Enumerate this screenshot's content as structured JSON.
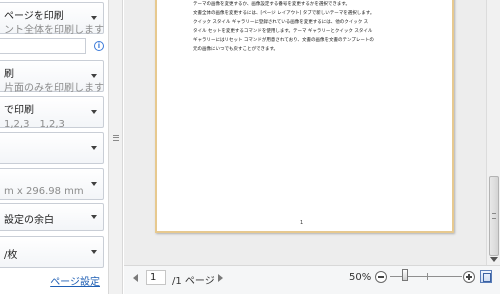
{
  "settings": {
    "print_pages": {
      "title": "ページを印刷",
      "subtitle": "ント全体を印刷します"
    },
    "sides": {
      "title": "刷",
      "subtitle": "片面のみを印刷します"
    },
    "collate": {
      "title": "で印刷",
      "subtitle": "1,2,3　1,2,3"
    },
    "paper_size": {
      "subtitle": "m x 296.98 mm"
    },
    "margins": {
      "title": "設定の余白"
    },
    "pages_per_sheet": {
      "title": "/枚"
    }
  },
  "page_setup_link": "ページ設定",
  "document": {
    "lines": [
      "テーマの画像を変更するか、画像設定する番号を変更するかを選択できます。",
      "文書全体の画像を変更するには、[ページ レイアウト] タブで新しいテーマを選択します。",
      "クイック スタイル ギャラリーに登録されている画像を変更するには、他のクイック ス",
      "タイル セットを変更するコマンドを使用します。テーマ ギャラリーとクイック スタイル",
      "ギャラリーにはリセット コマンドが用意されており、文書の画像を文書のテンプレートの",
      "元の画像にいつでも戻すことができます。"
    ],
    "page_number": "1"
  },
  "status": {
    "current_page": "1",
    "total_pages_label": "/1 ページ",
    "zoom_percent": "50%"
  }
}
